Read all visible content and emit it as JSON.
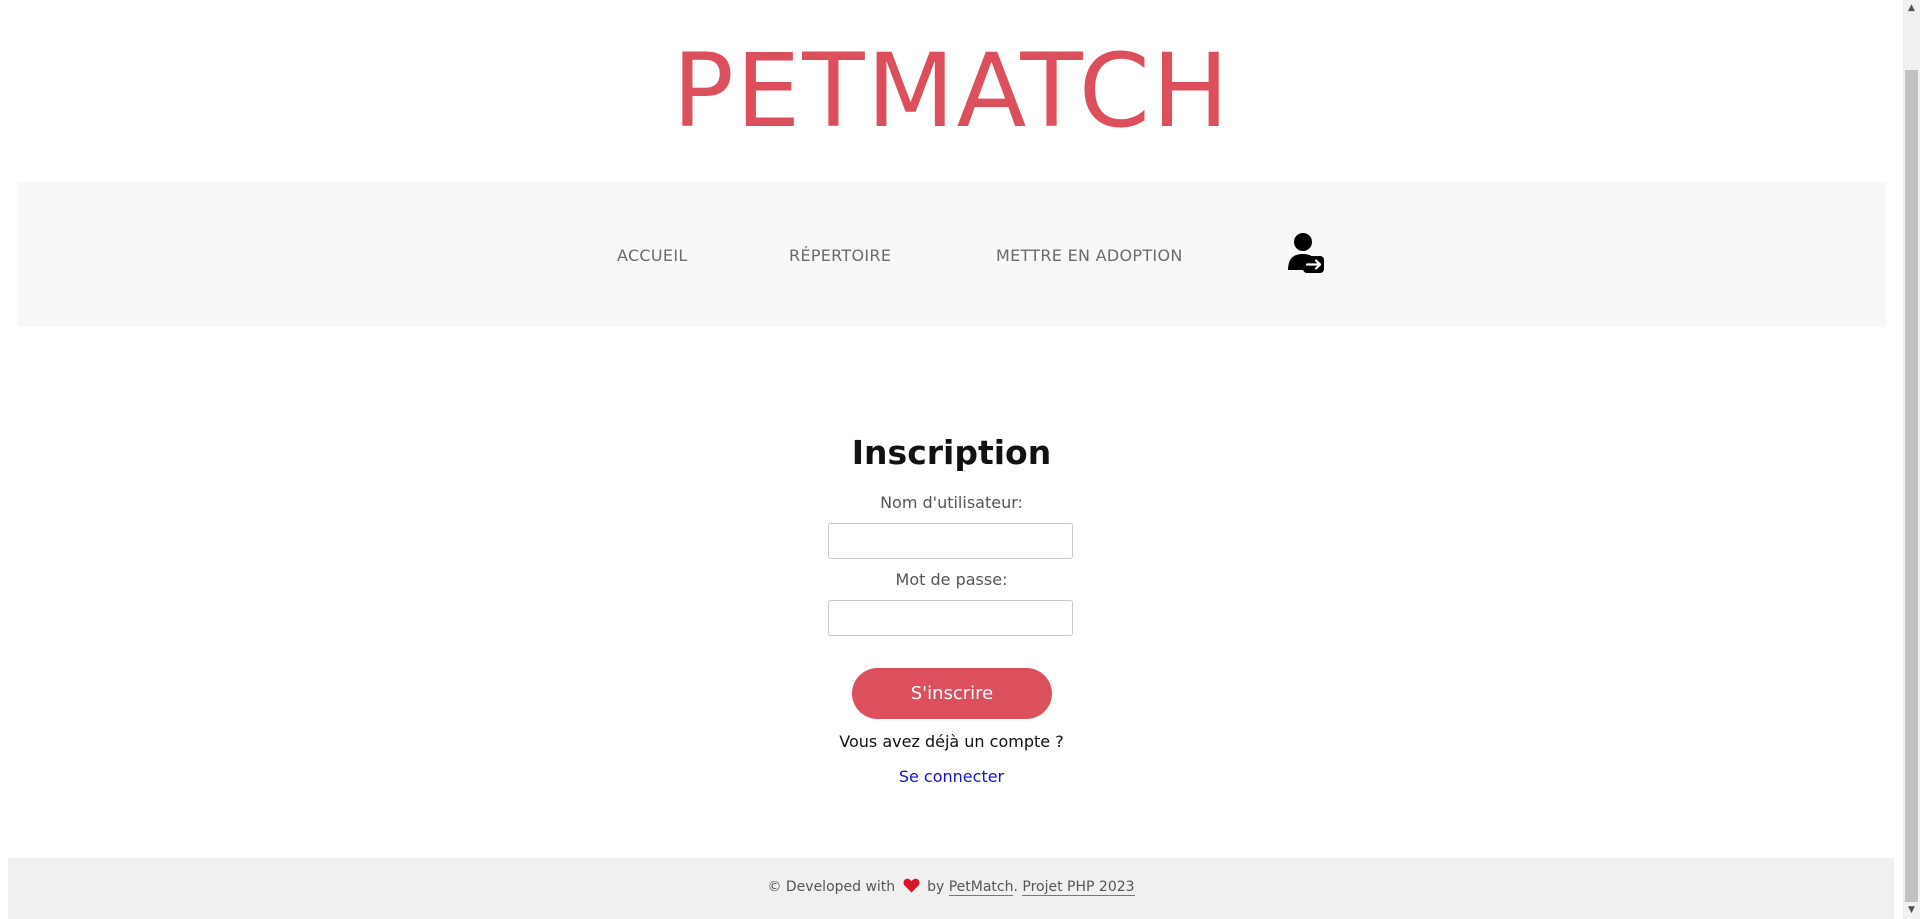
{
  "brand": {
    "logo": "PETMATCH",
    "accent_color": "#dc4f5c"
  },
  "nav": {
    "items": [
      {
        "label": "ACCUEIL"
      },
      {
        "label": "RÉPERTOIRE"
      },
      {
        "label": "METTRE EN ADOPTION"
      }
    ],
    "login_icon": "user-login-icon"
  },
  "form": {
    "title": "Inscription",
    "username_label": "Nom d'utilisateur:",
    "username_value": "",
    "password_label": "Mot de passe:",
    "password_value": "",
    "submit_label": "S'inscrire",
    "question": "Vous avez déjà un compte ?",
    "login_link": "Se connecter"
  },
  "footer": {
    "prefix": "© Developed with",
    "heart_icon": "heart-icon",
    "by": "by",
    "author": "PetMatch",
    "separator": ".",
    "project": "Projet PHP 2023"
  },
  "scrollbar": {
    "up_arrow": "▲",
    "down_arrow": "▼"
  }
}
